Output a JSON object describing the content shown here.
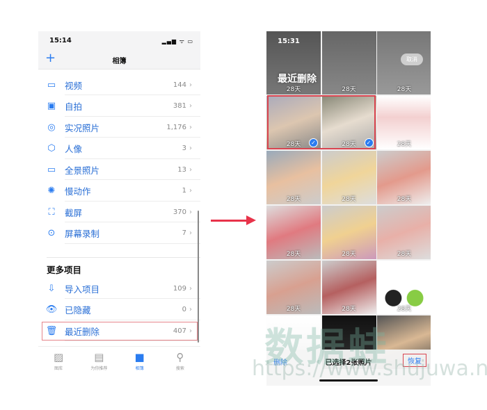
{
  "left": {
    "status": {
      "time": "15:14",
      "icons": "signal wifi battery-charging"
    },
    "nav": {
      "add_icon": "plus-icon",
      "title": "相簿"
    },
    "media_types": [
      {
        "icon": "video-icon",
        "label": "视频",
        "count": "144"
      },
      {
        "icon": "selfie-icon",
        "label": "自拍",
        "count": "381"
      },
      {
        "icon": "live-photo-icon",
        "label": "实况照片",
        "count": "1,176"
      },
      {
        "icon": "portrait-cube-icon",
        "label": "人像",
        "count": "3"
      },
      {
        "icon": "panorama-icon",
        "label": "全景照片",
        "count": "13"
      },
      {
        "icon": "slow-motion-icon",
        "label": "慢动作",
        "count": "1"
      },
      {
        "icon": "screenshot-icon",
        "label": "截屏",
        "count": "370"
      },
      {
        "icon": "screen-recording-icon",
        "label": "屏幕录制",
        "count": "7"
      }
    ],
    "more_section": {
      "title": "更多项目",
      "items": [
        {
          "icon": "import-icon",
          "label": "导入项目",
          "count": "109"
        },
        {
          "icon": "hidden-eye-icon",
          "label": "已隐藏",
          "count": "0"
        },
        {
          "icon": "trash-icon",
          "label": "最近删除",
          "count": "407"
        }
      ]
    },
    "tabs": [
      {
        "label": "图库",
        "icon": "photo-library-icon"
      },
      {
        "label": "为你推荐",
        "icon": "for-you-icon"
      },
      {
        "label": "相簿",
        "icon": "albums-icon",
        "active": true
      },
      {
        "label": "搜索",
        "icon": "search-icon"
      }
    ]
  },
  "right": {
    "status_time": "15:31",
    "title": "最近删除",
    "cancel": "取消",
    "days": "28天",
    "selected_cells": [
      3,
      4
    ],
    "bottom": {
      "delete": "删除",
      "selected": "已选择2张照片",
      "restore": "恢复"
    }
  },
  "watermark": {
    "text": "数据蛙",
    "url": "https://www.shujuwa.net"
  },
  "colors": {
    "accent": "#2a7cf0",
    "highlight": "#d94450",
    "arrow": "#e8334a"
  }
}
